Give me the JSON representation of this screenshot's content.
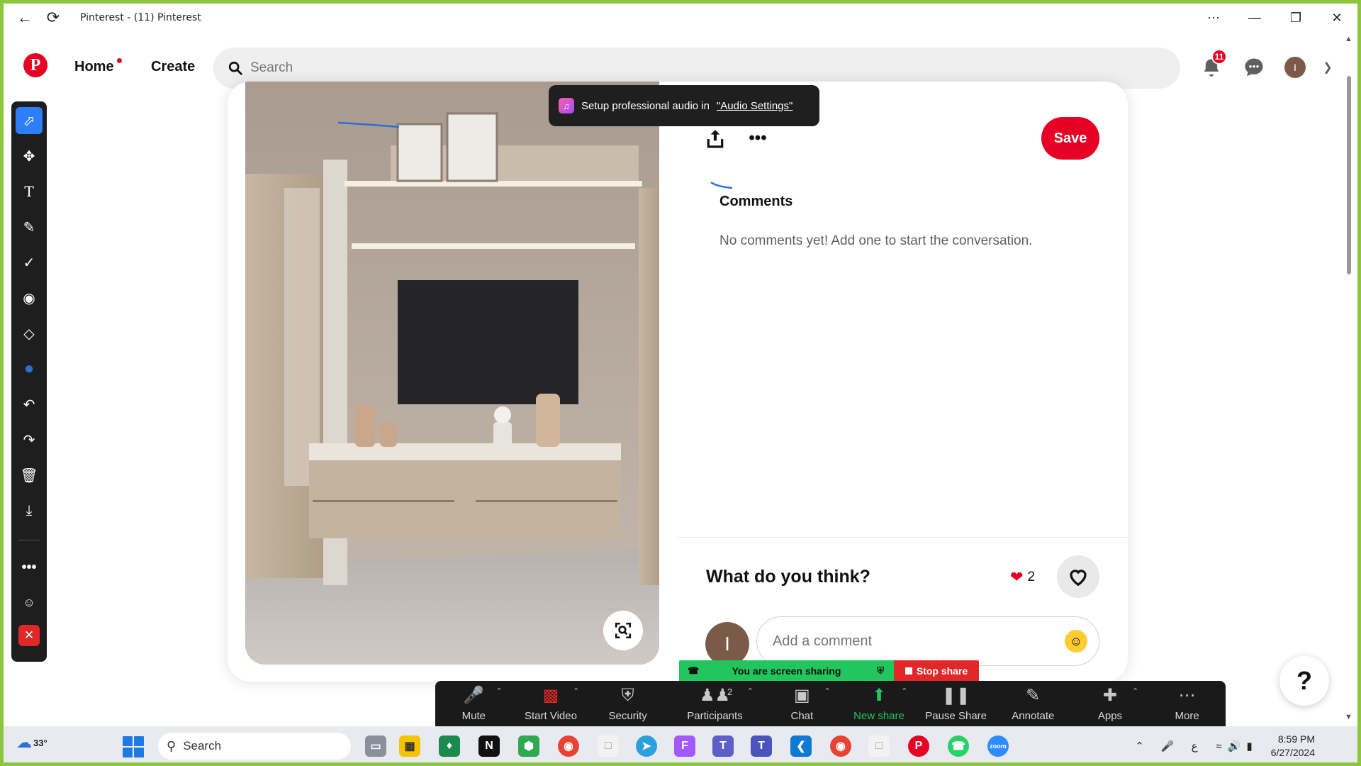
{
  "window": {
    "title": "Pinterest - (11) Pinterest"
  },
  "header": {
    "home_label": "Home",
    "create_label": "Create",
    "search_placeholder": "Search",
    "notification_count": "11",
    "avatar_initial": "I"
  },
  "toast": {
    "text": "Setup professional audio in",
    "link": "\"Audio Settings\""
  },
  "pin": {
    "save_label": "Save",
    "comments_heading": "Comments",
    "no_comments_text": "No comments yet! Add one to start the conversation.",
    "prompt": "What do you think?",
    "reaction_count": "2",
    "comment_placeholder": "Add a comment",
    "avatar_initial": "I"
  },
  "help_label": "?",
  "zoom": {
    "sharing_text": "You are screen sharing",
    "stop_share_label": "Stop share",
    "participants_count": "2",
    "items": [
      {
        "label": "Mute"
      },
      {
        "label": "Start Video"
      },
      {
        "label": "Security"
      },
      {
        "label": "Participants"
      },
      {
        "label": "Chat"
      },
      {
        "label": "New share"
      },
      {
        "label": "Pause Share"
      },
      {
        "label": "Annotate"
      },
      {
        "label": "Apps"
      },
      {
        "label": "More"
      }
    ]
  },
  "taskbar": {
    "weather": "33°",
    "search_label": "Search",
    "time": "8:59 PM",
    "date": "6/27/2024",
    "input_lang": "ع"
  },
  "colors": {
    "brand": "#e60023",
    "zoom_green": "#22c55e",
    "zoom_red": "#e02828",
    "frame_green": "#8cc63f"
  }
}
